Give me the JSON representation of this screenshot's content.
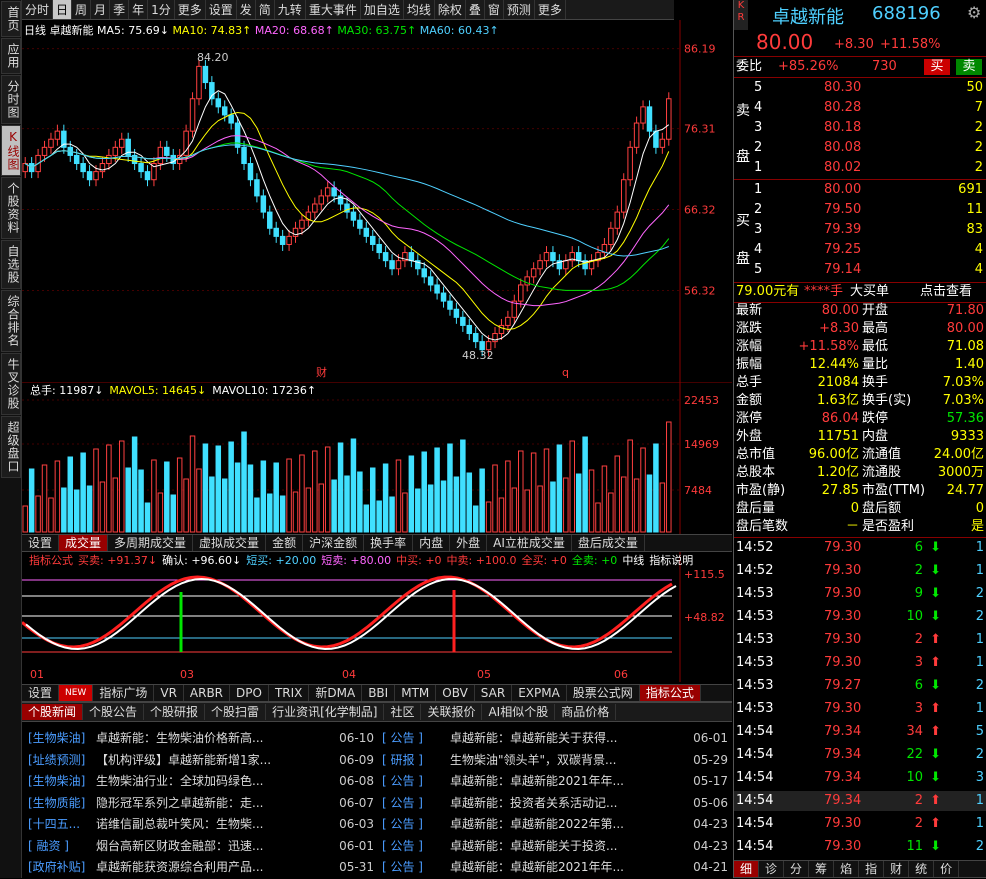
{
  "sidebar": [
    "首页",
    "应用",
    "分时图",
    "K线图",
    "个股资料",
    "自选股",
    "综合排名",
    "牛叉诊股",
    "超级盘口"
  ],
  "toolbar": [
    "分时",
    "日",
    "周",
    "月",
    "季",
    "年",
    "1分",
    "更多",
    "设置",
    "发",
    "简",
    "九转",
    "重大事件",
    "加自选",
    "均线",
    "除权",
    "叠",
    "窗",
    "预测",
    "更多"
  ],
  "legend": {
    "name": "日线 卓越新能",
    "ma5": "MA5: 75.69↓",
    "ma10": "MA10: 74.83↑",
    "ma20": "MA20: 68.68↑",
    "ma30": "MA30: 63.75↑",
    "ma60": "MA60: 60.43↑"
  },
  "price_axis": [
    "86.19",
    "76.31",
    "66.32",
    "56.32"
  ],
  "high_label": "84.20",
  "low_label": "48.32",
  "mark_cai": "财",
  "mark_q": "q",
  "vol_legend": {
    "a": "总手: 11987↓",
    "b": "MAVOL5: 14645↓",
    "c": "MAVOL10: 17236↑"
  },
  "vol_axis": [
    "22453",
    "14969",
    "7484"
  ],
  "vol_tabs": [
    "设置",
    "成交量",
    "多周期成交量",
    "虚拟成交量",
    "金额",
    "沪深金额",
    "换手率",
    "内盘",
    "外盘",
    "AI立桩成交量",
    "盘后成交量"
  ],
  "ind_legend": {
    "name": "指标公式",
    "buy": "买卖: +91.37↓",
    "confirm": "确认: +96.60↓",
    "sbuy": "短买: +20.00",
    "ssell": "短卖: +80.00",
    "mbuy": "中买: +0",
    "msell": "中卖: +100.0",
    "abuy": "全买: +0",
    "asell": "全卖: +0",
    "mid": "中线",
    "help": "指标说明"
  },
  "ind_axis": [
    "+115.5",
    "+48.82"
  ],
  "months": [
    "01",
    "03",
    "04",
    "05",
    "06"
  ],
  "ind_tabs": [
    "设置",
    "NEW",
    "指标广场",
    "VR",
    "ARBR",
    "DPO",
    "TRIX",
    "新DMA",
    "BBI",
    "MTM",
    "OBV",
    "SAR",
    "EXPMA",
    "股票公式网",
    "指标公式"
  ],
  "news_tabs": [
    "个股新闻",
    "个股公告",
    "个股研报",
    "个股扫雷",
    "行业资讯[化学制品]",
    "社区",
    "关联报价",
    "AI相似个股",
    "商品价格"
  ],
  "news_left": [
    {
      "tag": "[生物柴油]",
      "title": "卓越新能：生物柴油价格新高...",
      "date": "06-10"
    },
    {
      "tag": "[址绩预测]",
      "title": "【机构评级】卓越新能新增1家...",
      "date": "06-09"
    },
    {
      "tag": "[生物柴油]",
      "title": "生物柴油行业：全球加码绿色...",
      "date": "06-08"
    },
    {
      "tag": "[生物质能]",
      "title": "隐形冠军系列之卓越新能：走...",
      "date": "06-07"
    },
    {
      "tag": "[十四五...",
      "title": "诺维信副总裁叶笑风：生物柴...",
      "date": "06-03"
    },
    {
      "tag": "[ 融资 ]",
      "title": "烟台高新区财政金融部：迅速...",
      "date": "06-01"
    },
    {
      "tag": "[政府补贴]",
      "title": "卓越新能获资源综合利用产品...",
      "date": "05-31"
    }
  ],
  "news_right": [
    {
      "tag": "[ 公告 ]",
      "title": "卓越新能：卓越新能关于获得...",
      "date": "06-01"
    },
    {
      "tag": "[ 研报 ]",
      "title": "生物柴油\"领头羊\"，双碳背景...",
      "date": "05-29"
    },
    {
      "tag": "[ 公告 ]",
      "title": "卓越新能：卓越新能2021年年...",
      "date": "05-17"
    },
    {
      "tag": "[ 公告 ]",
      "title": "卓越新能：投资者关系活动记...",
      "date": "05-06"
    },
    {
      "tag": "[ 公告 ]",
      "title": "卓越新能：卓越新能2022年第...",
      "date": "04-23"
    },
    {
      "tag": "[ 公告 ]",
      "title": "卓越新能：卓越新能关于投资...",
      "date": "04-23"
    },
    {
      "tag": "[ 公告 ]",
      "title": "卓越新能：卓越新能2021年年...",
      "date": "04-21"
    }
  ],
  "quote": {
    "kr": "K R",
    "name": "卓越新能",
    "code": "688196",
    "price": "80.00",
    "chg": "+8.30",
    "pct": "+11.58%",
    "wb_label": "委比",
    "wb": "+85.26%",
    "wc": "730",
    "buy": "买",
    "sell": "卖",
    "ask_side": "卖盘",
    "bid_side": "买盘",
    "asks": [
      {
        "l": "5",
        "p": "80.30",
        "v": "50"
      },
      {
        "l": "4",
        "p": "80.28",
        "v": "7"
      },
      {
        "l": "3",
        "p": "80.18",
        "v": "2"
      },
      {
        "l": "2",
        "p": "80.08",
        "v": "2"
      },
      {
        "l": "1",
        "p": "80.02",
        "v": "2"
      }
    ],
    "bids": [
      {
        "l": "1",
        "p": "80.00",
        "v": "691"
      },
      {
        "l": "2",
        "p": "79.50",
        "v": "11"
      },
      {
        "l": "3",
        "p": "79.39",
        "v": "83"
      },
      {
        "l": "4",
        "p": "79.25",
        "v": "4"
      },
      {
        "l": "5",
        "p": "79.14",
        "v": "4"
      }
    ],
    "bigorder": {
      "a": "79.00元有",
      "b": "****手",
      "c": "大买单",
      "d": "点击查看"
    },
    "stats": [
      [
        "最新",
        "80.00",
        "开盘",
        "71.80"
      ],
      [
        "涨跌",
        "+8.30",
        "最高",
        "80.00"
      ],
      [
        "涨幅",
        "+11.58%",
        "最低",
        "71.08"
      ],
      [
        "振幅",
        "12.44%",
        "量比",
        "1.40"
      ],
      [
        "总手",
        "21084",
        "换手",
        "7.03%"
      ],
      [
        "金额",
        "1.63亿",
        "换手(实)",
        "7.03%"
      ],
      [
        "涨停",
        "86.04",
        "跌停",
        "57.36"
      ],
      [
        "外盘",
        "11751",
        "内盘",
        "9333"
      ],
      [
        "总市值",
        "96.00亿",
        "流通值",
        "24.00亿"
      ],
      [
        "总股本",
        "1.20亿",
        "流通股",
        "3000万"
      ],
      [
        "市盈(静)",
        "27.85",
        "市盈(TTM)",
        "24.77"
      ],
      [
        "盘后量",
        "0",
        "盘后额",
        "0"
      ],
      [
        "盘后笔数",
        "－",
        "是否盈利",
        "是"
      ]
    ],
    "ticks": [
      [
        "14:52",
        "79.30",
        "6",
        "down",
        "1"
      ],
      [
        "14:52",
        "79.30",
        "2",
        "down",
        "1"
      ],
      [
        "14:53",
        "79.30",
        "9",
        "down",
        "2"
      ],
      [
        "14:53",
        "79.30",
        "10",
        "down",
        "2"
      ],
      [
        "14:53",
        "79.30",
        "2",
        "up",
        "1"
      ],
      [
        "14:53",
        "79.30",
        "3",
        "up",
        "1"
      ],
      [
        "14:53",
        "79.27",
        "6",
        "down",
        "2"
      ],
      [
        "14:53",
        "79.30",
        "3",
        "up",
        "1"
      ],
      [
        "14:54",
        "79.34",
        "34",
        "up",
        "5"
      ],
      [
        "14:54",
        "79.34",
        "22",
        "down",
        "2"
      ],
      [
        "14:54",
        "79.34",
        "10",
        "down",
        "3"
      ],
      [
        "14:54",
        "79.34",
        "2",
        "up",
        "1"
      ],
      [
        "14:54",
        "79.30",
        "2",
        "up",
        "1"
      ],
      [
        "14:54",
        "79.30",
        "11",
        "down",
        "2"
      ]
    ],
    "bottom_tabs": [
      "细",
      "诊",
      "分",
      "筹",
      "焰",
      "指",
      "财",
      "统",
      "价"
    ]
  },
  "chart_data": {
    "type": "candlestick",
    "ylim": [
      46,
      88
    ],
    "closes": [
      72,
      71,
      73,
      74,
      75,
      76,
      74,
      73,
      72,
      71,
      70,
      71,
      72,
      73,
      74,
      75,
      73,
      72,
      71,
      70,
      72,
      74,
      73,
      72,
      73,
      76,
      80,
      84,
      82,
      80,
      79,
      78,
      77,
      74,
      72,
      70,
      68,
      66,
      64,
      63,
      62,
      63,
      64,
      65,
      66,
      67,
      68,
      69,
      68,
      67,
      66,
      65,
      64,
      63,
      62,
      61,
      60,
      59,
      60,
      61,
      60,
      59,
      58,
      57,
      56,
      55,
      54,
      53,
      52,
      51,
      50,
      49,
      50,
      51,
      52,
      53,
      55,
      57,
      58,
      59,
      60,
      61,
      60,
      59,
      60,
      61,
      60,
      59,
      60,
      61,
      62,
      64,
      66,
      70,
      74,
      77,
      79,
      76,
      74,
      75,
      80
    ]
  }
}
